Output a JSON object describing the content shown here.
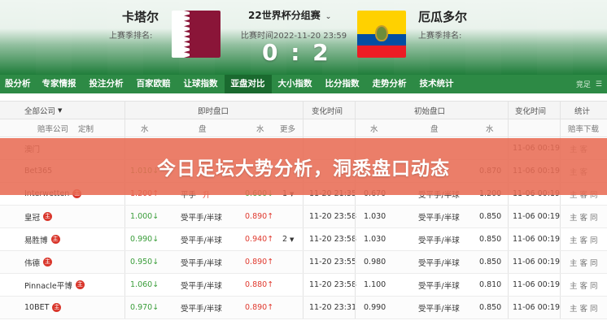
{
  "match": {
    "home_name": "卡塔尔",
    "home_rank": "上赛季排名:",
    "away_name": "厄瓜多尔",
    "away_rank": "上赛季排名:",
    "title": "22世界杯分组赛",
    "time": "比赛时间2022-11-20 23:59",
    "score": "0 : 2"
  },
  "tabs": [
    "股分析",
    "专家情报",
    "投注分析",
    "百家欧赔",
    "让球指数",
    "亚盘对比",
    "大小指数",
    "比分指数",
    "走势分析",
    "技术统计"
  ],
  "active_tab": "亚盘对比",
  "tab_right": "竞足",
  "table": {
    "headers": {
      "company": "全部公司",
      "live": "即时盘口",
      "change_time": "变化时间",
      "initial": "初始盘口",
      "change_time2": "变化时间",
      "stats": "统计"
    },
    "subheaders": {
      "rate": "赔率公司",
      "custom": "定制",
      "water1": "水",
      "pan1": "盘",
      "water2": "水",
      "more": "更多",
      "water3": "水",
      "pan2": "盘",
      "water4": "水",
      "stat": "赔率下载"
    },
    "rows": [
      {
        "company": "澳门",
        "badge": "",
        "w1": "",
        "w1_dir": "",
        "pan": "",
        "pan_extra": "",
        "w2": "",
        "w2_dir": "",
        "more": "",
        "t1": "",
        "iw1": "",
        "ipan": "",
        "iw2": "",
        "t2": "11-06 00:19",
        "stat": "主 客"
      },
      {
        "company": "Bet365",
        "badge": "",
        "w1": "1.010",
        "w1_dir": "↓",
        "pan": "",
        "pan_extra": "",
        "w2": "",
        "w2_dir": "",
        "more": "",
        "t1": "",
        "iw1": "",
        "ipan": "",
        "iw2": "0.870",
        "t2": "11-06 00:19",
        "stat": "主 客"
      },
      {
        "company": "Interwetten",
        "badge": "主",
        "w1": "1.200",
        "w1_dir": "↑",
        "pan": "平手",
        "pan_extra": "升",
        "w2": "0.600",
        "w2_dir": "↓",
        "more": "1",
        "t1": "11-20 21:35",
        "iw1": "0.670",
        "ipan": "受平手/半球",
        "iw2": "1.200",
        "t2": "11-06 00:19",
        "stat": "主 客 同"
      },
      {
        "company": "皇冠",
        "badge": "主",
        "w1": "1.000",
        "w1_dir": "↓",
        "pan": "受平手/半球",
        "pan_extra": "",
        "w2": "0.890",
        "w2_dir": "↑",
        "more": "",
        "t1": "11-20 23:58",
        "iw1": "1.030",
        "ipan": "受平手/半球",
        "iw2": "0.850",
        "t2": "11-06 00:19",
        "stat": "主 客 同"
      },
      {
        "company": "易胜博",
        "badge": "主",
        "w1": "0.990",
        "w1_dir": "↓",
        "pan": "受平手/半球",
        "pan_extra": "",
        "w2": "0.940",
        "w2_dir": "↑",
        "more": "2",
        "t1": "11-20 23:58",
        "iw1": "1.030",
        "ipan": "受平手/半球",
        "iw2": "0.850",
        "t2": "11-06 00:19",
        "stat": "主 客 同"
      },
      {
        "company": "伟德",
        "badge": "主",
        "w1": "0.950",
        "w1_dir": "↓",
        "pan": "受平手/半球",
        "pan_extra": "",
        "w2": "0.890",
        "w2_dir": "↑",
        "more": "",
        "t1": "11-20 23:55",
        "iw1": "0.980",
        "ipan": "受平手/半球",
        "iw2": "0.850",
        "t2": "11-06 00:19",
        "stat": "主 客 同"
      },
      {
        "company": "Pinnacle平博",
        "badge": "主",
        "w1": "1.060",
        "w1_dir": "↓",
        "pan": "受平手/半球",
        "pan_extra": "",
        "w2": "0.880",
        "w2_dir": "↑",
        "more": "",
        "t1": "11-20 23:58",
        "iw1": "1.100",
        "ipan": "受平手/半球",
        "iw2": "0.810",
        "t2": "11-06 00:19",
        "stat": "主 客 同"
      },
      {
        "company": "10BET",
        "badge": "主",
        "w1": "0.970",
        "w1_dir": "↓",
        "pan": "受平手/半球",
        "pan_extra": "",
        "w2": "0.890",
        "w2_dir": "↑",
        "more": "",
        "t1": "11-20 23:31",
        "iw1": "0.990",
        "ipan": "受平手/半球",
        "iw2": "0.850",
        "t2": "11-06 00:19",
        "stat": "主 客 同"
      }
    ]
  },
  "banner": "今日足坛大势分析，洞悉盘口动态",
  "colors": {
    "pitch_green": "#1f7d3a",
    "tab_green": "#2d8a45",
    "active_tab": "#1a6a2f",
    "up_red": "#e03a2f",
    "down_green": "#3a9d3a",
    "banner": "#e86c54"
  }
}
